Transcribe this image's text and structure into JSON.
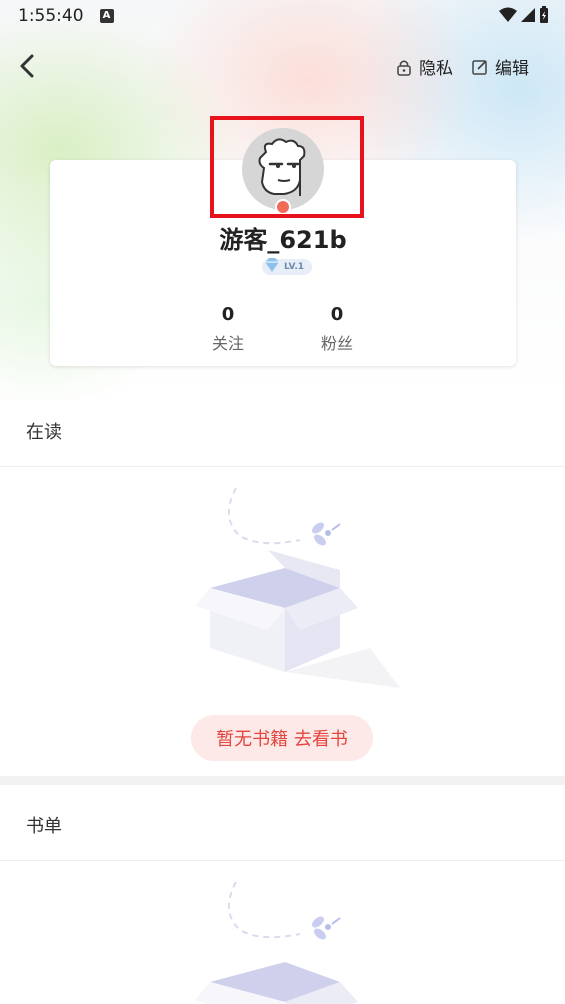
{
  "status_bar": {
    "time": "1:55:40",
    "notification_icon": "a-icon"
  },
  "nav": {
    "back_icon": "chevron-left-icon",
    "privacy_label": "隐私",
    "edit_label": "编辑"
  },
  "profile": {
    "username": "游客_621b",
    "level": "LV.1",
    "stats": [
      {
        "value": "0",
        "label": "关注"
      },
      {
        "value": "0",
        "label": "粉丝"
      }
    ]
  },
  "sections": {
    "reading": {
      "title": "在读",
      "empty_button": "暂无书籍 去看书"
    },
    "booklist": {
      "title": "书单"
    }
  },
  "colors": {
    "accent": "#e4453e",
    "highlight": "#e8121d",
    "badge_bg": "#fde9e8"
  }
}
